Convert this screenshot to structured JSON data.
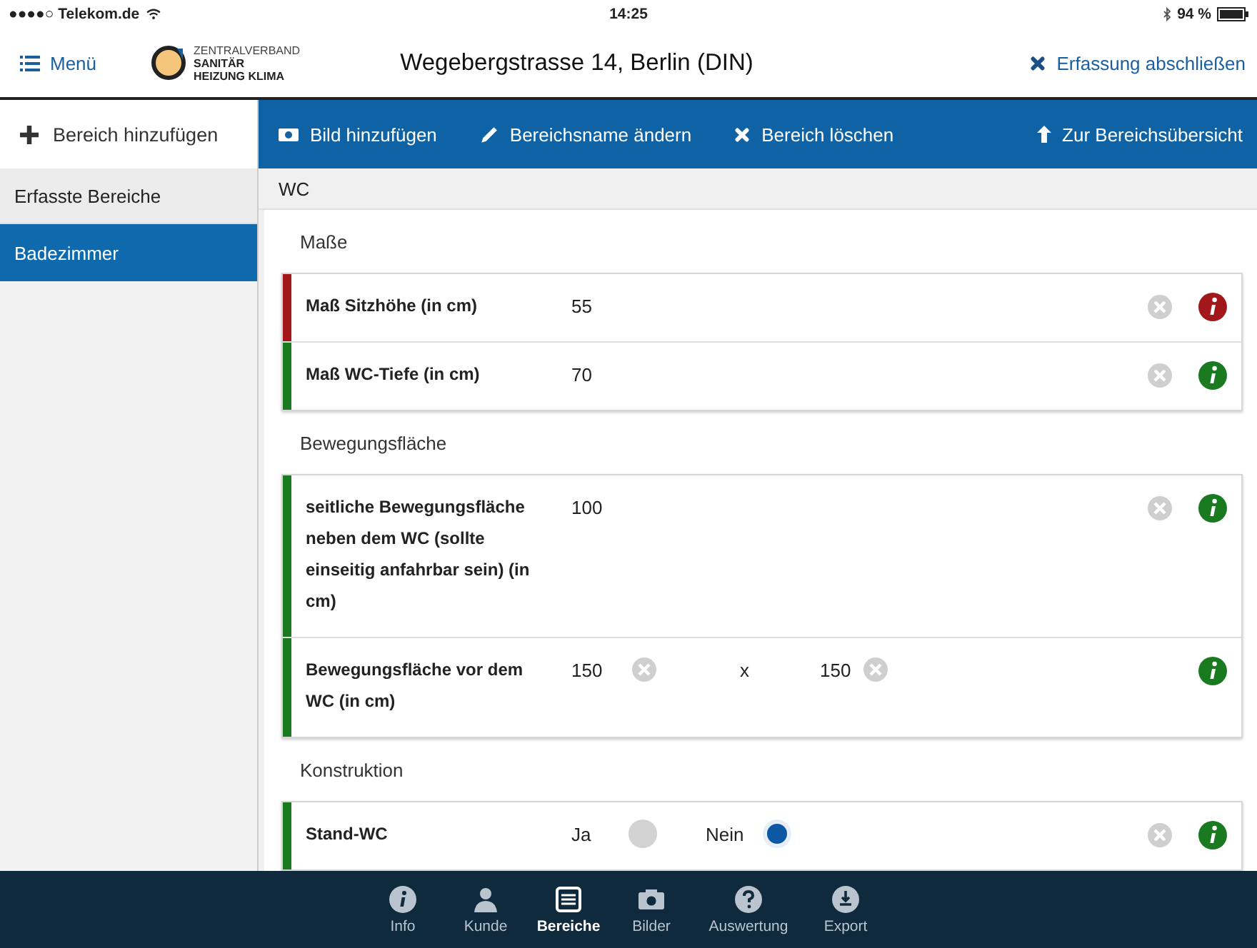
{
  "status_bar": {
    "carrier": "●●●●○ Telekom.de",
    "time": "14:25",
    "battery": "94 %"
  },
  "header": {
    "menu": "Menü",
    "logo_lines": [
      "ZENTRALVERBAND",
      "SANITÄR",
      "HEIZUNG KLIMA"
    ],
    "title": "Wegebergstrasse 14, Berlin (DIN)",
    "finish": "Erfassung abschließen"
  },
  "sidebar": {
    "add": "Bereich hinzufügen",
    "heading": "Erfasste Bereiche",
    "items": [
      {
        "label": "Badezimmer",
        "selected": true
      }
    ]
  },
  "toolbar": [
    {
      "kind": "camera",
      "label": "Bild hinzufügen"
    },
    {
      "kind": "pencil",
      "label": "Bereichsname ändern"
    },
    {
      "kind": "cross",
      "label": "Bereich löschen"
    },
    {
      "kind": "up",
      "label": "Zur Bereichsübersicht"
    }
  ],
  "area_title": "WC",
  "sections": [
    {
      "title": "Maße",
      "rows": [
        {
          "kind": "single",
          "color": "#a3171b",
          "label": "Maß Sitzhöhe (in cm)",
          "value": "55"
        },
        {
          "kind": "single",
          "color": "#1a7a1f",
          "label": "Maß WC-Tiefe (in cm)",
          "value": "70"
        }
      ]
    },
    {
      "title": "Bewegungsfläche",
      "rows": [
        {
          "kind": "single",
          "color": "#1a7a1f",
          "label": "seitliche Bewegungsfläche neben dem WC (sollte einseitig anfahrbar sein) (in cm)",
          "value": "100"
        },
        {
          "kind": "pair",
          "color": "#1a7a1f",
          "label": "Bewegungsfläche vor dem WC (in cm)",
          "value": "150",
          "separator": "x",
          "value2": "150"
        }
      ]
    },
    {
      "title": "Konstruktion",
      "rows": [
        {
          "kind": "radio",
          "color": "#1a7a1f",
          "label": "Stand-WC",
          "options": [
            {
              "label": "Ja",
              "selected": false
            },
            {
              "label": "Nein",
              "selected": true
            }
          ]
        }
      ]
    }
  ],
  "tabbar": [
    {
      "kind": "info",
      "label": "Info",
      "selected": false
    },
    {
      "kind": "person",
      "label": "Kunde",
      "selected": false
    },
    {
      "kind": "list",
      "label": "Bereiche",
      "selected": true
    },
    {
      "kind": "camera",
      "label": "Bilder",
      "selected": false
    },
    {
      "kind": "question",
      "label": "Auswertung",
      "selected": false
    },
    {
      "kind": "export",
      "label": "Export",
      "selected": false
    }
  ]
}
